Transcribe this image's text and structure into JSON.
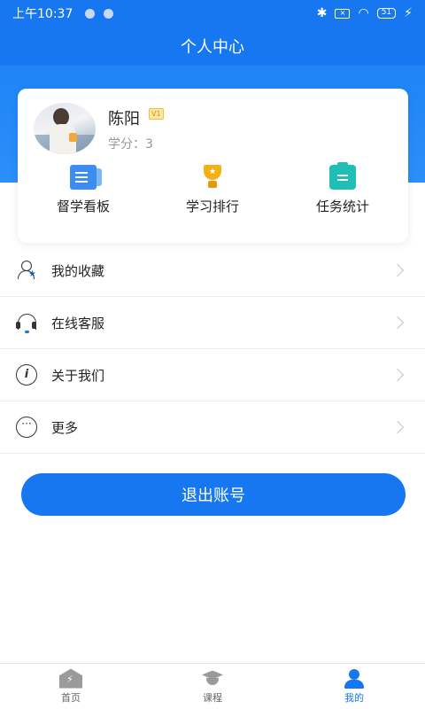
{
  "status_bar": {
    "time": "上午10:37",
    "battery": "51"
  },
  "header": {
    "title": "个人中心"
  },
  "profile": {
    "name": "陈阳",
    "vip_badge": "V1",
    "score_text": "学分：3"
  },
  "quick_actions": [
    {
      "label": "督学看板",
      "icon": "board-icon"
    },
    {
      "label": "学习排行",
      "icon": "trophy-icon"
    },
    {
      "label": "任务统计",
      "icon": "task-icon"
    }
  ],
  "menu": [
    {
      "label": "我的收藏",
      "icon": "favorites-icon"
    },
    {
      "label": "在线客服",
      "icon": "headset-icon"
    },
    {
      "label": "关于我们",
      "icon": "info-icon"
    },
    {
      "label": "更多",
      "icon": "more-icon"
    }
  ],
  "logout_label": "退出账号",
  "tabs": [
    {
      "label": "首页",
      "icon": "home-icon"
    },
    {
      "label": "课程",
      "icon": "graduation-cap-icon"
    },
    {
      "label": "我的",
      "icon": "user-icon"
    }
  ],
  "colors": {
    "primary": "#1677f0"
  }
}
